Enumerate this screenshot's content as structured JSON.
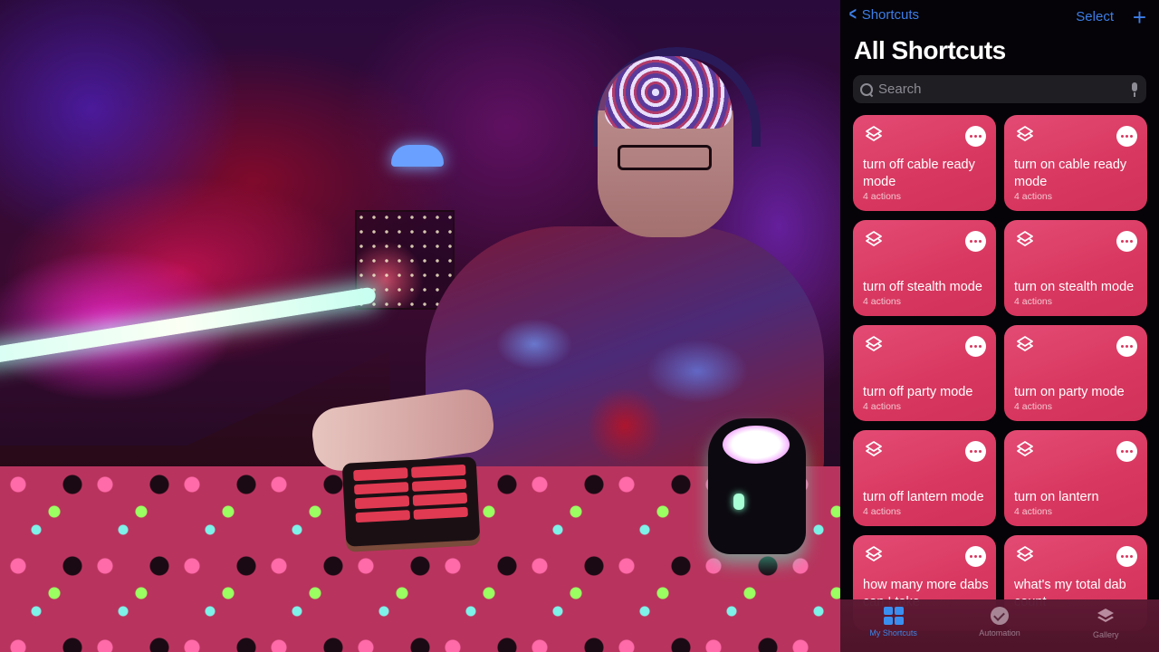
{
  "nav": {
    "back_label": "Shortcuts",
    "select_label": "Select",
    "add_label": "+"
  },
  "title": "All Shortcuts",
  "search": {
    "placeholder": "Search",
    "value": ""
  },
  "shortcuts": [
    {
      "title": "turn off cable ready mode",
      "subtitle": "4 actions"
    },
    {
      "title": "turn on cable ready mode",
      "subtitle": "4 actions"
    },
    {
      "title": "turn off stealth mode",
      "subtitle": "4 actions"
    },
    {
      "title": "turn on stealth mode",
      "subtitle": "4 actions"
    },
    {
      "title": "turn off party mode",
      "subtitle": "4 actions"
    },
    {
      "title": "turn on party mode",
      "subtitle": "4 actions"
    },
    {
      "title": "turn off lantern mode",
      "subtitle": "4 actions"
    },
    {
      "title": "turn on lantern",
      "subtitle": "4 actions"
    },
    {
      "title": "how many more dabs can I take",
      "subtitle": ""
    },
    {
      "title": "what's my total dab count",
      "subtitle": ""
    }
  ],
  "tabs": [
    {
      "label": "My Shortcuts",
      "icon": "grid-icon",
      "active": true
    },
    {
      "label": "Automation",
      "icon": "clock-check-icon",
      "active": false
    },
    {
      "label": "Gallery",
      "icon": "layers-icon",
      "active": false
    }
  ],
  "colors": {
    "accent": "#3d7ee8",
    "card": "#d8375f",
    "panel_bg": "#050307"
  }
}
